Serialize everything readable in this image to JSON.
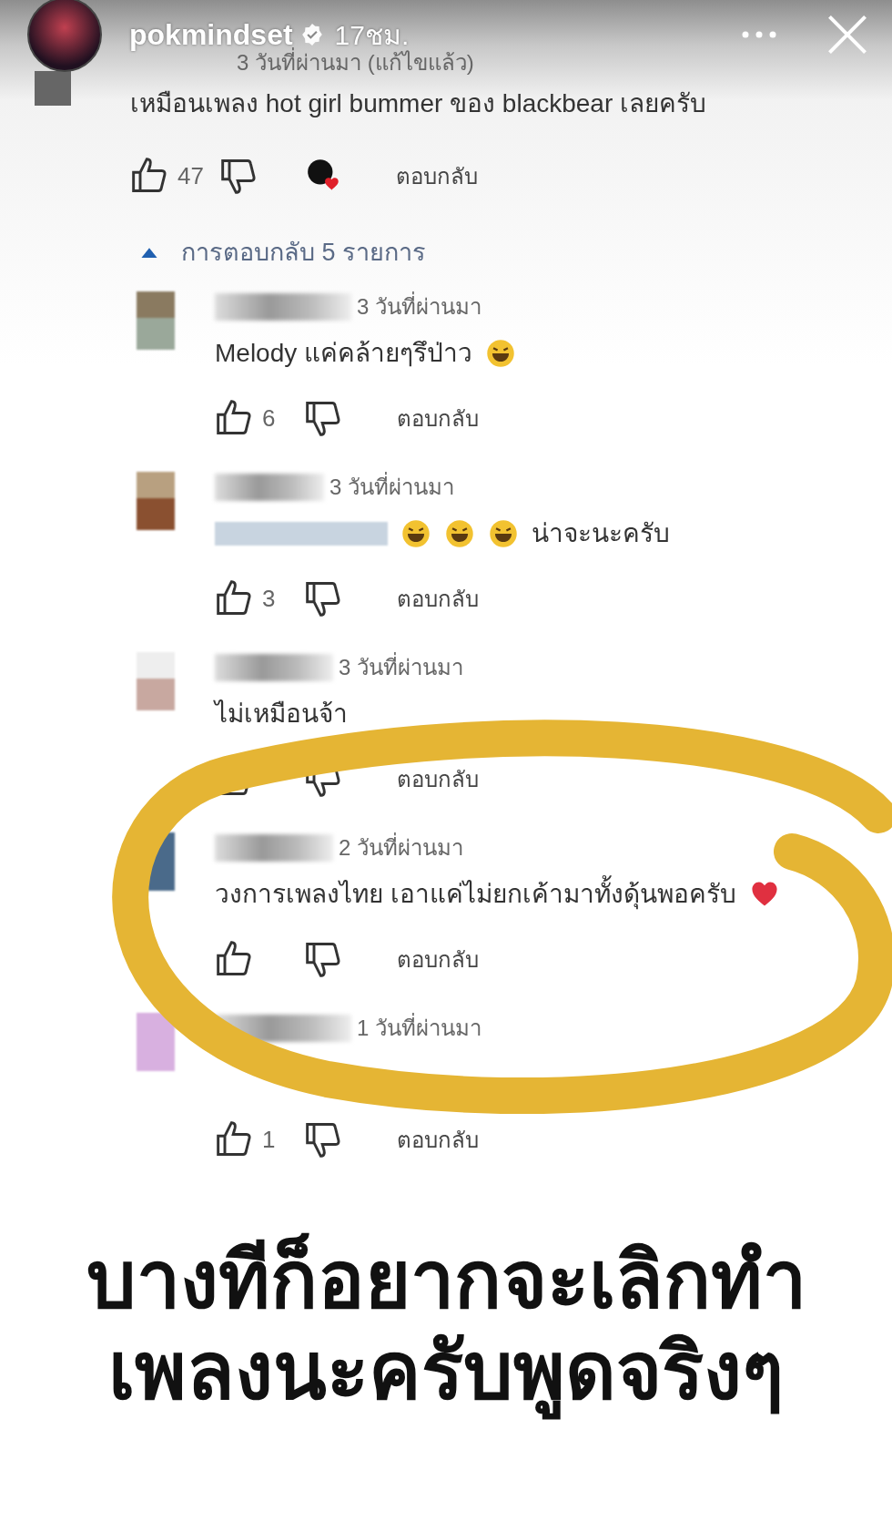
{
  "story": {
    "username": "pokmindset",
    "verified": true,
    "time": "17ชม."
  },
  "comment": {
    "meta": "3 วันที่ผ่านมา (แก้ไขแล้ว)",
    "body": "เหมือนเพลง hot girl bummer ของ blackbear เลยครับ",
    "likes": "47",
    "creator_heart": true,
    "reply": "ตอบกลับ"
  },
  "replies_toggle": {
    "label": "การตอบกลับ 5 รายการ",
    "expanded": true
  },
  "replies": [
    {
      "kind": "laugh",
      "meta": "3 วันที่ผ่านมา",
      "body": "Melody แค่คล้ายๆรึป่าว",
      "likes": "6",
      "reply": "ตอบกลับ"
    },
    {
      "kind": "mention",
      "meta": "3 วันที่ผ่านมา",
      "body": "น่าจะนะครับ",
      "likes": "3",
      "reply": "ตอบกลับ"
    },
    {
      "kind": "plain",
      "meta": "3 วันที่ผ่านมา",
      "body": "ไม่เหมือนจ้า",
      "reply": "ตอบกลับ"
    },
    {
      "kind": "heart",
      "meta": "2 วันที่ผ่านมา",
      "body": "วงการเพลงไทย เอาแค่ไม่ยกเค้ามาทั้งดุ้นพอครับ",
      "reply": "ตอบกลับ"
    },
    {
      "kind": "covered",
      "meta": "1 วันที่ผ่านมา",
      "likes": "1",
      "reply": "ตอบกลับ"
    }
  ],
  "caption": [
    "บางทีก็อยากจะเลิกทำ",
    "เพลงนะครับพูดจริงๆ"
  ]
}
